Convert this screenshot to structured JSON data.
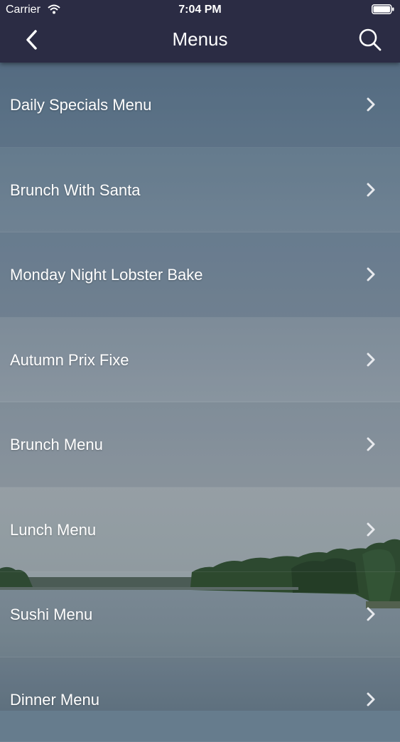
{
  "status_bar": {
    "carrier": "Carrier",
    "time": "7:04 PM"
  },
  "nav": {
    "title": "Menus",
    "back_icon": "chevron-left-icon",
    "search_icon": "search-icon"
  },
  "menus": [
    {
      "label": "Daily Specials Menu"
    },
    {
      "label": "Brunch With Santa"
    },
    {
      "label": "Monday Night Lobster Bake"
    },
    {
      "label": "Autumn Prix Fixe"
    },
    {
      "label": "Brunch Menu"
    },
    {
      "label": "Lunch Menu"
    },
    {
      "label": "Sushi Menu"
    },
    {
      "label": "Dinner Menu"
    }
  ],
  "colors": {
    "nav_background": "#2b2c44",
    "text": "#ffffff"
  }
}
